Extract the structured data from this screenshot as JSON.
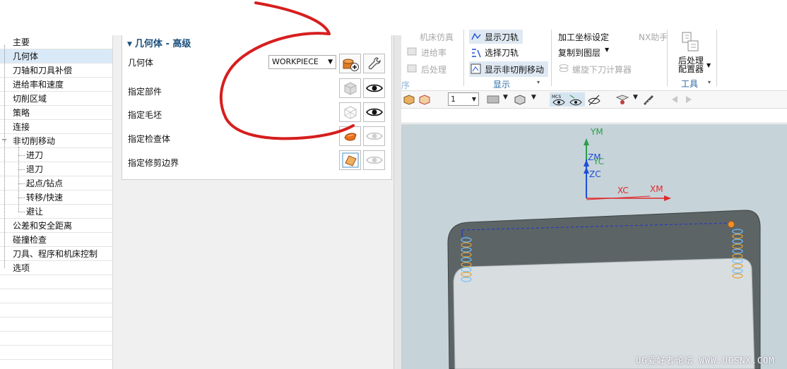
{
  "tree": {
    "items": [
      {
        "label": "主要",
        "level": 0
      },
      {
        "label": "几何体",
        "level": 0,
        "selected": true
      },
      {
        "label": "刀轴和刀具补偿",
        "level": 0
      },
      {
        "label": "进给率和速度",
        "level": 0
      },
      {
        "label": "切削区域",
        "level": 0
      },
      {
        "label": "策略",
        "level": 0
      },
      {
        "label": "连接",
        "level": 0
      },
      {
        "label": "非切削移动",
        "level": 0,
        "expanded": true
      },
      {
        "label": "进刀",
        "level": 1
      },
      {
        "label": "退刀",
        "level": 1
      },
      {
        "label": "起点/钻点",
        "level": 1
      },
      {
        "label": "转移/快速",
        "level": 1
      },
      {
        "label": "避让",
        "level": 1
      },
      {
        "label": "公差和安全距离",
        "level": 0
      },
      {
        "label": "碰撞检查",
        "level": 0
      },
      {
        "label": "刀具、程序和机床控制",
        "level": 0
      },
      {
        "label": "选项",
        "level": 0
      }
    ]
  },
  "panel": {
    "title": "几何体 - 高级",
    "geometry_label": "几何体",
    "geometry_value": "WORKPIECE",
    "rows": {
      "part": "指定部件",
      "blank": "指定毛坯",
      "check": "指定检查体",
      "trim": "指定修剪边界"
    }
  },
  "ribbon": {
    "machine_tool": "机床仿真",
    "feedrate": "进给率",
    "postprocess": "后处理",
    "show_path": "显示刀轨",
    "select_path": "选择刀轨",
    "show_noncut": "显示非切削移动",
    "display_group": "显示",
    "machine_coord": "加工坐标设定",
    "nx_assistant": "NX助手",
    "copy_layer": "复制到图层",
    "spiral_calc": "螺旋下刀计算器",
    "post_config": "后处理配置器",
    "tools_group": "工具",
    "layer_value": "1"
  },
  "viewport": {
    "axes": {
      "ym": "YM",
      "zm": "ZM",
      "yc": "YC",
      "zc": "ZC",
      "xc": "XC",
      "xm": "XM"
    },
    "watermark": "UG爱好者论坛 WWW.UCSNX.COM"
  },
  "colors": {
    "accent": "#1a4f7d",
    "selection": "#d9e9f7",
    "viewport_bg": "#c6d3d9",
    "annotation": "#d71e1e",
    "axis_y": "#2e9e4a",
    "axis_z": "#1d4fd6",
    "axis_x": "#e02a2a"
  }
}
